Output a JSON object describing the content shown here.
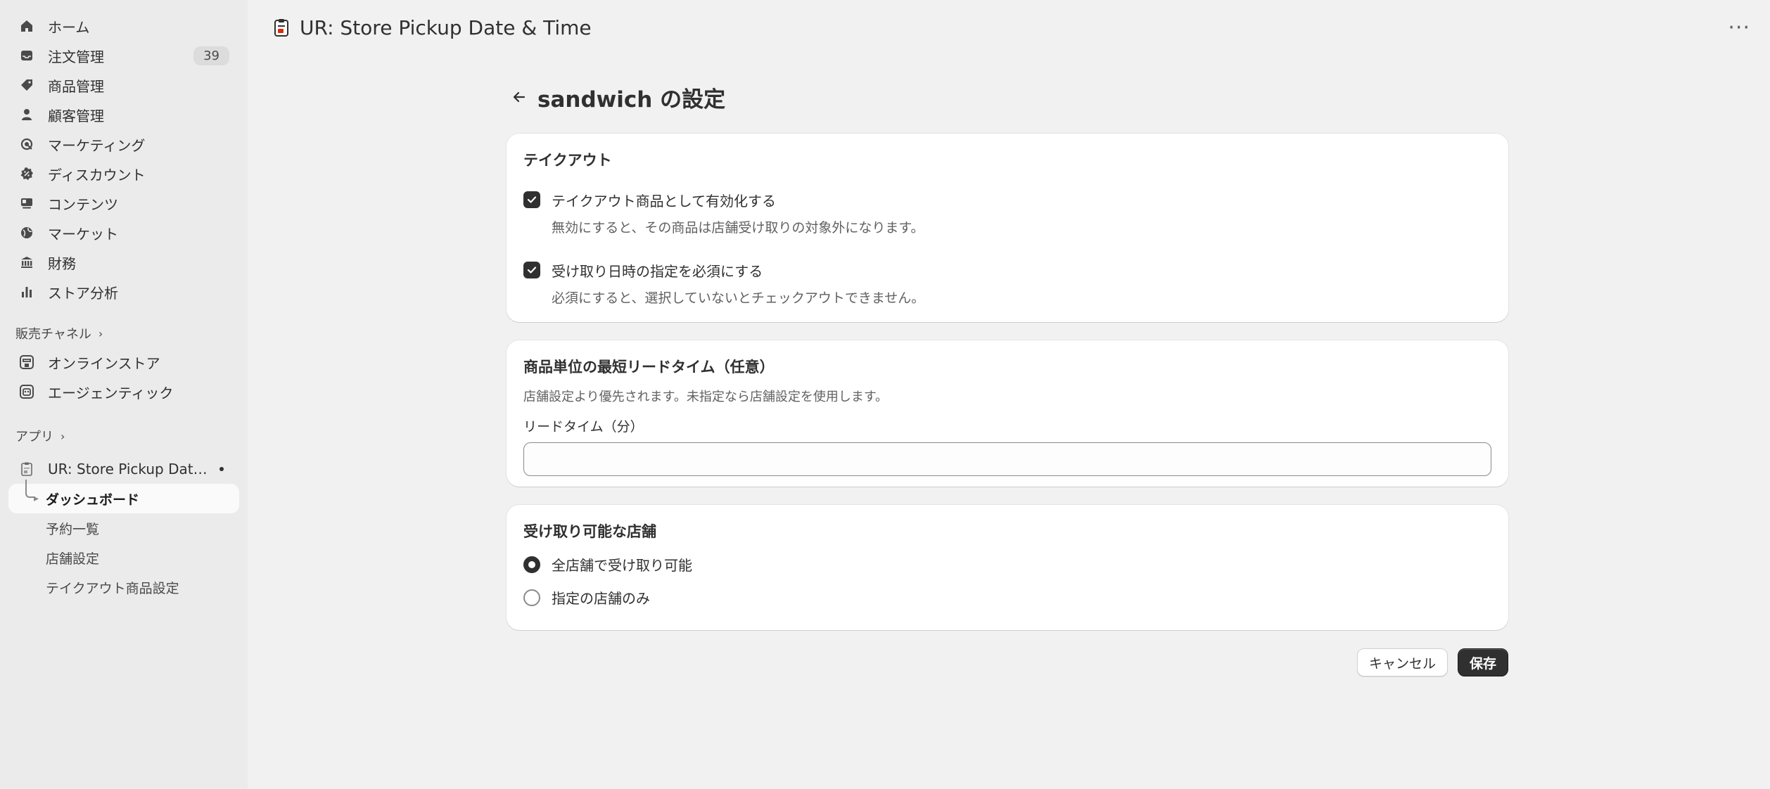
{
  "sidebar": {
    "items": [
      {
        "label": "ホーム",
        "icon": "home-icon"
      },
      {
        "label": "注文管理",
        "icon": "inbox-icon",
        "badge": "39"
      },
      {
        "label": "商品管理",
        "icon": "tag-icon"
      },
      {
        "label": "顧客管理",
        "icon": "person-icon"
      },
      {
        "label": "マーケティング",
        "icon": "target-icon"
      },
      {
        "label": "ディスカウント",
        "icon": "discount-icon"
      },
      {
        "label": "コンテンツ",
        "icon": "content-icon"
      },
      {
        "label": "マーケット",
        "icon": "globe-icon"
      },
      {
        "label": "財務",
        "icon": "bank-icon"
      },
      {
        "label": "ストア分析",
        "icon": "bar-chart-icon"
      }
    ],
    "sales_channels": {
      "heading": "販売チャネル",
      "items": [
        {
          "label": "オンラインストア",
          "icon": "store-icon"
        },
        {
          "label": "エージェンティック",
          "icon": "robot-icon"
        }
      ]
    },
    "apps": {
      "heading": "アプリ",
      "app_name": "UR: Store Pickup Date...",
      "sub_items": [
        "ダッシュボード",
        "予約一覧",
        "店舗設定",
        "テイクアウト商品設定"
      ]
    }
  },
  "topbar": {
    "title": "UR: Store Pickup Date & Time",
    "more": "···"
  },
  "page": {
    "title": "sandwich の設定"
  },
  "takeout_card": {
    "title": "テイクアウト",
    "enable_label": "テイクアウト商品として有効化する",
    "enable_help": "無効にすると、その商品は店舗受け取りの対象外になります。",
    "enable_checked": true,
    "require_label": "受け取り日時の指定を必須にする",
    "require_help": "必須にすると、選択していないとチェックアウトできません。",
    "require_checked": true
  },
  "leadtime_card": {
    "title": "商品単位の最短リードタイム（任意）",
    "help": "店舗設定より優先されます。未指定なら店舗設定を使用します。",
    "field_label": "リードタイム（分）",
    "value": "",
    "placeholder": ""
  },
  "stores_card": {
    "title": "受け取り可能な店舗",
    "options": [
      {
        "label": "全店舗で受け取り可能",
        "selected": true
      },
      {
        "label": "指定の店舗のみ",
        "selected": false
      }
    ]
  },
  "actions": {
    "cancel": "キャンセル",
    "save": "保存"
  }
}
